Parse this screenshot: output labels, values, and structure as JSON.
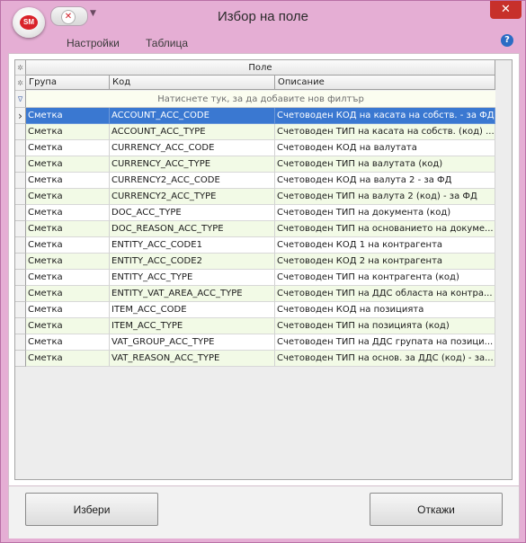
{
  "window": {
    "title": "Избор на поле",
    "app_logo": "SM",
    "close_glyph": "✕",
    "qat_glyph": "✕",
    "qat_dropdown_glyph": "▼"
  },
  "menu": {
    "items": [
      "Настройки",
      "Таблица"
    ],
    "help_glyph": "?"
  },
  "grid": {
    "band_header": "Поле",
    "columns": [
      "Група",
      "Код",
      "Описание"
    ],
    "filter_placeholder": "Натиснете тук, за да добавите нов филтър",
    "indicator_glyphs": {
      "corner": "✲",
      "filter": "∇",
      "current": "›"
    },
    "rows": [
      {
        "group": "Сметка",
        "code": "ACCOUNT_ACC_CODE",
        "description": "Счетоводен КОД на касата на собств. - за ФД",
        "selected": true
      },
      {
        "group": "Сметка",
        "code": "ACCOUNT_ACC_TYPE",
        "description": "Счетоводен ТИП на касата на собств. (код) ..."
      },
      {
        "group": "Сметка",
        "code": "CURRENCY_ACC_CODE",
        "description": "Счетоводен КОД на валутата"
      },
      {
        "group": "Сметка",
        "code": "CURRENCY_ACC_TYPE",
        "description": "Счетоводен ТИП на валутата (код)"
      },
      {
        "group": "Сметка",
        "code": "CURRENCY2_ACC_CODE",
        "description": "Счетоводен КОД на валута 2 - за ФД"
      },
      {
        "group": "Сметка",
        "code": "CURRENCY2_ACC_TYPE",
        "description": "Счетоводен ТИП на валута 2 (код) - за ФД"
      },
      {
        "group": "Сметка",
        "code": "DOC_ACC_TYPE",
        "description": "Счетоводен ТИП на документа (код)"
      },
      {
        "group": "Сметка",
        "code": "DOC_REASON_ACC_TYPE",
        "description": "Счетоводен ТИП на основанието на докуме..."
      },
      {
        "group": "Сметка",
        "code": "ENTITY_ACC_CODE1",
        "description": "Счетоводен КОД 1 на контрагента"
      },
      {
        "group": "Сметка",
        "code": "ENTITY_ACC_CODE2",
        "description": "Счетоводен КОД 2 на контрагента"
      },
      {
        "group": "Сметка",
        "code": "ENTITY_ACC_TYPE",
        "description": "Счетоводен ТИП на контрагента (код)"
      },
      {
        "group": "Сметка",
        "code": "ENTITY_VAT_AREA_ACC_TYPE",
        "description": "Счетоводен ТИП на ДДС областа на контра..."
      },
      {
        "group": "Сметка",
        "code": "ITEM_ACC_CODE",
        "description": "Счетоводен КОД на позицията"
      },
      {
        "group": "Сметка",
        "code": "ITEM_ACC_TYPE",
        "description": "Счетоводен ТИП на позицията (код)"
      },
      {
        "group": "Сметка",
        "code": "VAT_GROUP_ACC_TYPE",
        "description": "Счетоводен ТИП на ДДС групата на позици..."
      },
      {
        "group": "Сметка",
        "code": "VAT_REASON_ACC_TYPE",
        "description": "Счетоводен ТИП на основ. за ДДС (код) - за..."
      }
    ]
  },
  "footer": {
    "select_label": "Избери",
    "cancel_label": "Откажи"
  },
  "colors": {
    "window_frame": "#e5aed4",
    "selection": "#3a78d1",
    "alt_row": "#f2fae6",
    "close_button": "#c7302b"
  }
}
